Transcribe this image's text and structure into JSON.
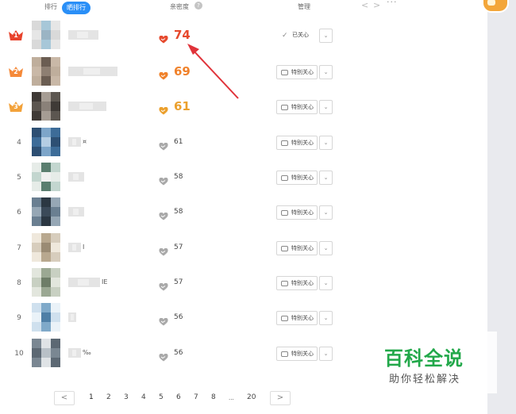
{
  "header": {
    "tab_rank": "排行",
    "tab_active": "晒排行",
    "col_intimacy": "亲密度",
    "help_icon": "?",
    "col_manage": "管理",
    "nav_prev": "<",
    "nav_next": ">",
    "more": "···"
  },
  "rows": [
    {
      "rank": "1",
      "score": "74",
      "button": "已关心",
      "followed": true
    },
    {
      "rank": "2",
      "score": "69",
      "button": "特别关心",
      "followed": false
    },
    {
      "rank": "3",
      "score": "61",
      "button": "特别关心",
      "followed": false
    },
    {
      "rank": "4",
      "score": "61",
      "button": "特别关心",
      "followed": false
    },
    {
      "rank": "5",
      "score": "58",
      "button": "特别关心",
      "followed": false
    },
    {
      "rank": "6",
      "score": "58",
      "button": "特别关心",
      "followed": false
    },
    {
      "rank": "7",
      "score": "57",
      "button": "特别关心",
      "followed": false
    },
    {
      "rank": "8",
      "score": "57",
      "button": "特别关心",
      "followed": false
    },
    {
      "rank": "9",
      "score": "56",
      "button": "特别关心",
      "followed": false
    },
    {
      "rank": "10",
      "score": "56",
      "button": "特别关心",
      "followed": false
    }
  ],
  "name_tails": [
    "",
    "",
    "",
    "¤",
    "",
    "",
    "I",
    "IE",
    "",
    "‰"
  ],
  "pagination": {
    "prev": "<",
    "pages": [
      "1",
      "2",
      "3",
      "4",
      "5",
      "6",
      "7",
      "8",
      "...",
      "20"
    ],
    "next": ">"
  },
  "watermark": {
    "title": "百科全说",
    "subtitle": "助你轻松解决"
  },
  "colors": {
    "accent": "#2a8ff7",
    "rank1_crown": "#e8432c",
    "rank2_crown": "#f58a3a",
    "rank3_crown": "#f3a23a",
    "score1": "#e64a2e",
    "score2": "#f0822b",
    "score3": "#eba02d",
    "heart_grey": "#a9a9a9",
    "arrow": "#e0333a",
    "watermark_green": "#22a84a"
  },
  "icons": {
    "crown": "crown-icon",
    "heart": "heart-icon",
    "check": "check-icon",
    "follow": "heart-outline-icon",
    "dropdown": "chevron-down-icon"
  }
}
